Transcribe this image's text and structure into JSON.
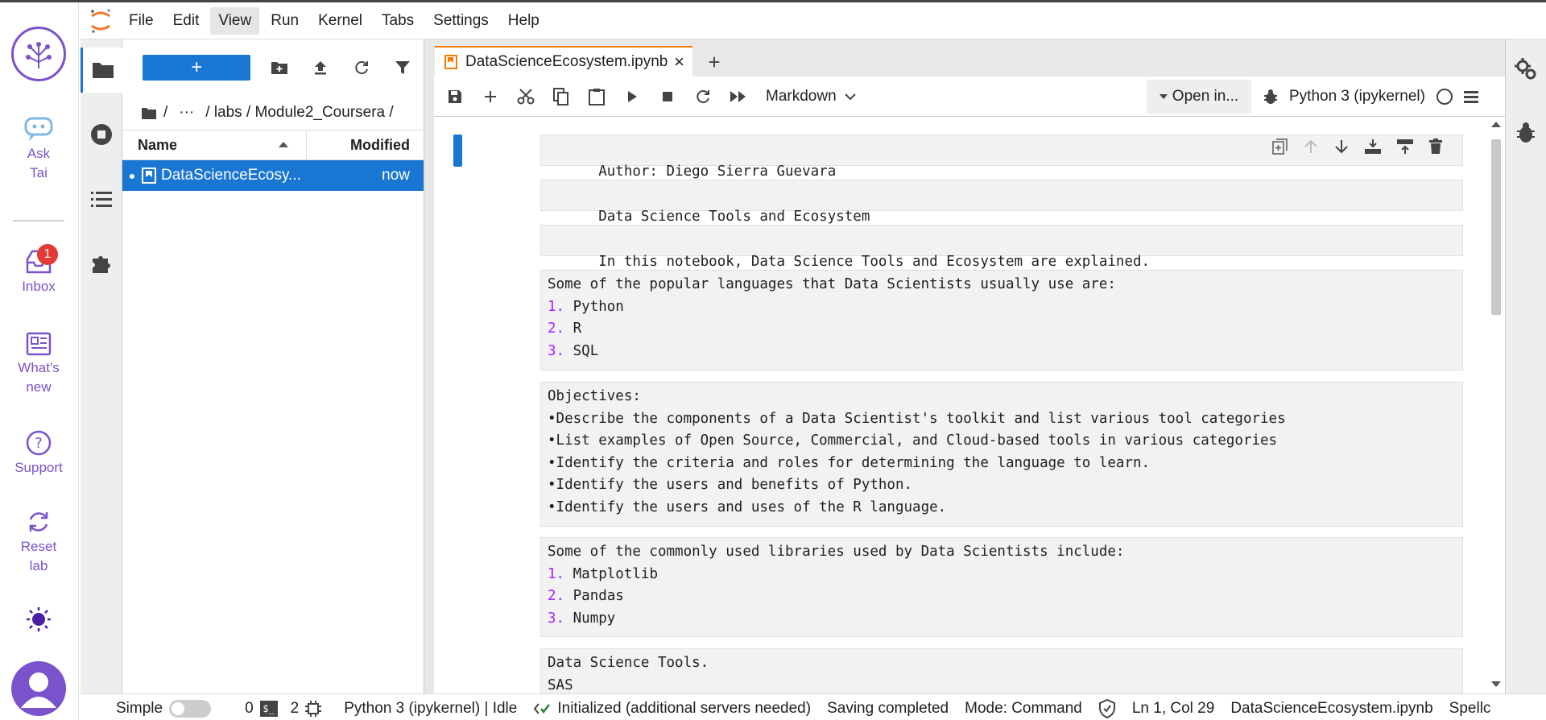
{
  "outer_rail": {
    "items": [
      {
        "label": "Ask Tai"
      },
      {
        "label": "Inbox",
        "badge": "1"
      },
      {
        "label": "What's new"
      },
      {
        "label": "Support"
      },
      {
        "label": "Reset lab"
      }
    ]
  },
  "menubar": {
    "items": [
      "File",
      "Edit",
      "View",
      "Run",
      "Kernel",
      "Tabs",
      "Settings",
      "Help"
    ],
    "active": "View"
  },
  "file_browser": {
    "new_button": "+",
    "breadcrumb": [
      "/",
      "···",
      "/ labs / Module2_Coursera /"
    ],
    "columns": {
      "name": "Name",
      "modified": "Modified"
    },
    "files": [
      {
        "name": "DataScienceEcosystem.ipynb",
        "display": "DataScienceEcosy...",
        "modified": "now"
      }
    ]
  },
  "tabs": [
    {
      "label": "DataScienceEcosystem.ipynb",
      "close": "×"
    }
  ],
  "add_tab": "+",
  "toolbar": {
    "cell_type": "Markdown",
    "open_in": "Open in...",
    "kernel": "Python 3 (ipykernel)"
  },
  "cells": [
    {
      "lines": [
        "Author: Diego Sierra Guevara"
      ]
    },
    {
      "lines": [
        "Data Science Tools and Ecosystem"
      ]
    },
    {
      "lines": [
        "In this notebook, Data Science Tools and Ecosystem are explained."
      ]
    },
    {
      "lines": [
        "Some of the popular languages that Data Scientists usually use are:"
      ],
      "items": [
        [
          "1.",
          "Python"
        ],
        [
          "2.",
          "R"
        ],
        [
          "3.",
          "SQL"
        ]
      ]
    },
    {
      "lines": [
        "Objectives:",
        "•Describe the components of a Data Scientist's toolkit and list various tool categories",
        "•List examples of Open Source, Commercial, and Cloud-based tools in various categories",
        "•Identify the criteria and roles for determining the language to learn.",
        "•Identify the users and benefits of Python.",
        "•Identify the users and uses of the R language."
      ]
    },
    {
      "lines": [
        "Some of the commonly used libraries used by Data Scientists include:"
      ],
      "items": [
        [
          "1.",
          "Matplotlib"
        ],
        [
          "2.",
          "Pandas"
        ],
        [
          "3.",
          "Numpy"
        ]
      ]
    },
    {
      "lines": [
        "Data Science Tools.",
        "SAS"
      ]
    }
  ],
  "statusbar": {
    "mode_label": "Simple",
    "terminals": "0",
    "kernels": "2",
    "kernel_status": "Python 3 (ipykernel) | Idle",
    "lsp": "Initialized (additional servers needed)",
    "save_status": "Saving completed",
    "mode": "Mode: Command",
    "position": "Ln 1, Col 29",
    "filename": "DataScienceEcosystem.ipynb",
    "spell": "Spellc"
  }
}
